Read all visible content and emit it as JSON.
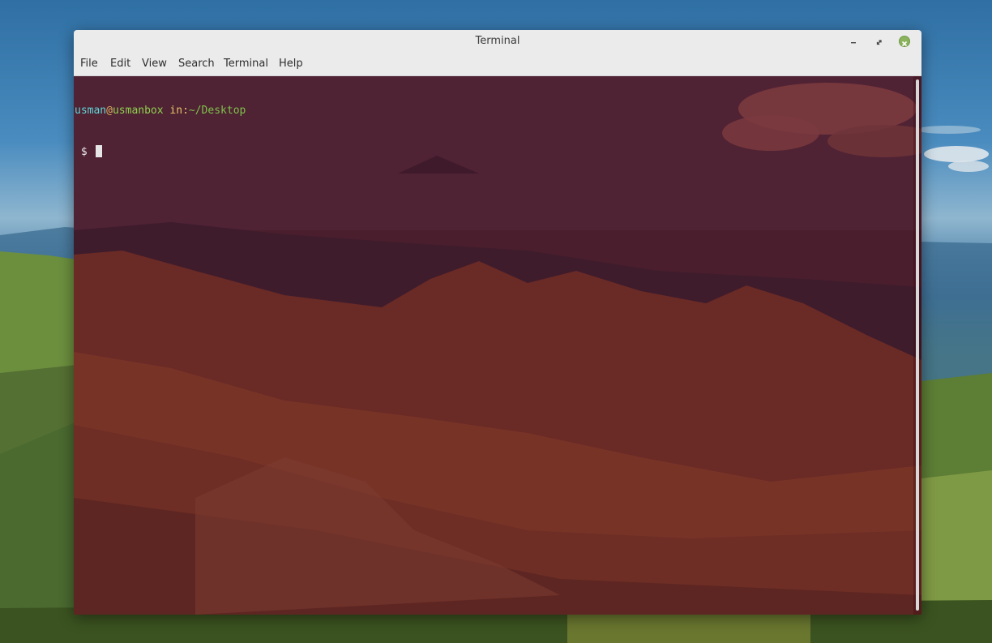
{
  "window": {
    "title": "Terminal",
    "controls": {
      "minimize": "minimize-icon",
      "maximize": "maximize-icon",
      "close": "close-icon"
    }
  },
  "menubar": {
    "items": [
      "File",
      "Edit",
      "View",
      "Search",
      "Terminal",
      "Help"
    ]
  },
  "terminal": {
    "prompt": {
      "user": "usman",
      "at": "@",
      "host": "usmanbox",
      "in": " in:",
      "path": "~/Desktop",
      "symbol": " $ "
    },
    "background_tint": "#64141e"
  },
  "colors": {
    "titlebar": "#ebebeb",
    "close_button": "#8ab35b",
    "user": "#5fd7d7",
    "host": "#8fd14f",
    "path": "#7fc24a"
  }
}
